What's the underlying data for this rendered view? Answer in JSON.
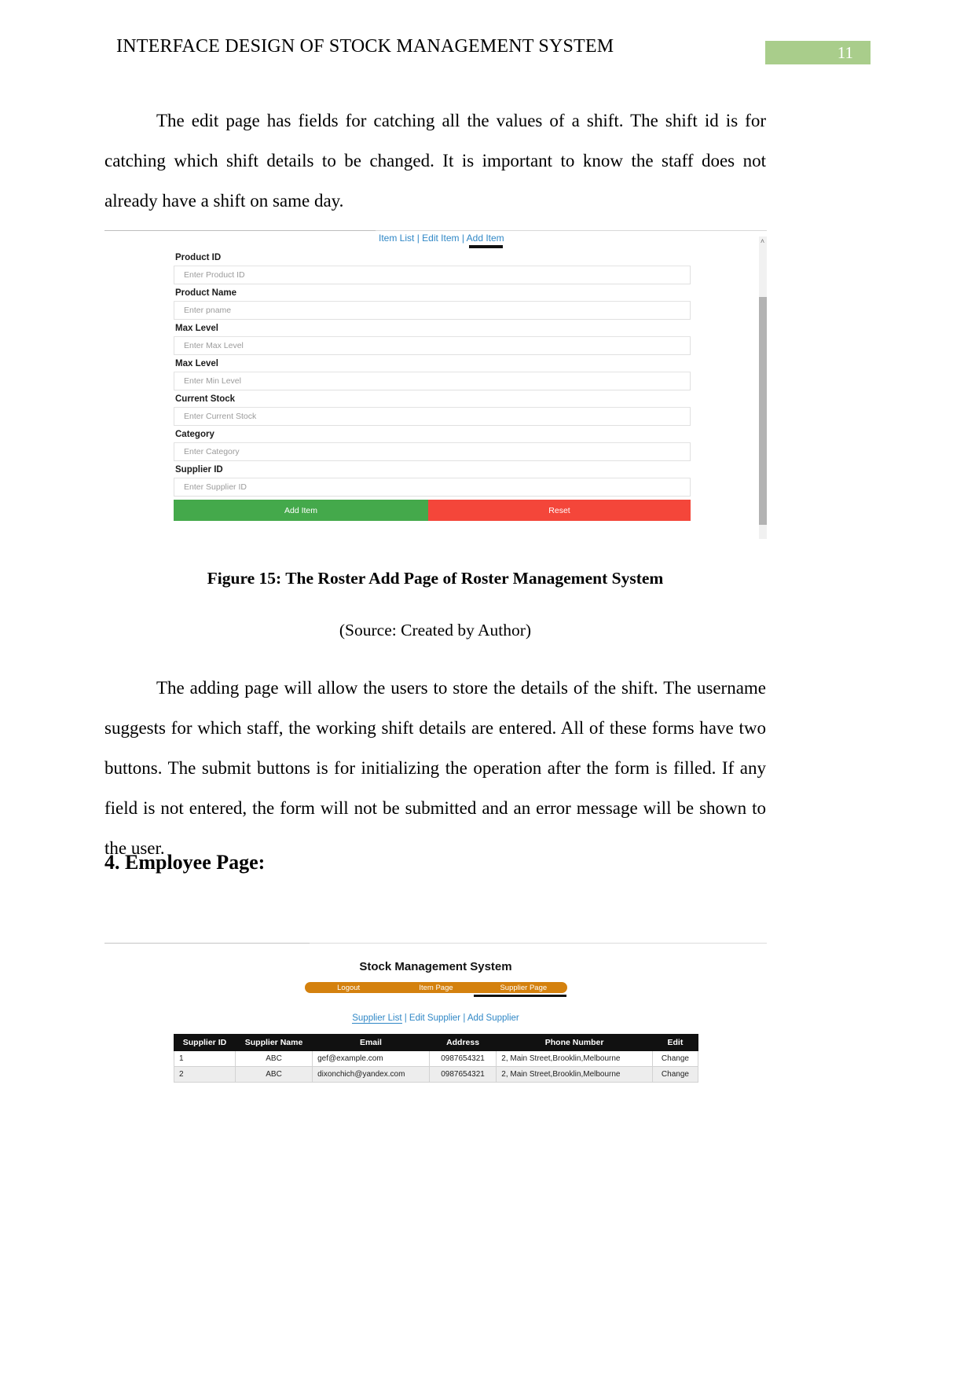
{
  "header": {
    "running_title": "INTERFACE DESIGN OF STOCK MANAGEMENT SYSTEM",
    "page_number": "11",
    "badge_color": "#a9cd8b"
  },
  "paragraphs": {
    "p1": "The edit page has fields for catching all the values of a shift. The shift id is for catching which shift details to be changed. It is important to know the staff does not already have a shift on same day.",
    "p2": "The adding page will allow the users to store the details of the shift. The username suggests for which staff, the working shift details are entered. All of these forms have two buttons. The submit buttons is for initializing the operation after the form is filled. If any field is not entered, the form will not be submitted and an error message will be shown to the user."
  },
  "figure1": {
    "caption": "Figure 15: The Roster Add Page of Roster Management System",
    "source": "(Source: Created by Author)",
    "nav": {
      "item_list": "Item List",
      "separator": " | ",
      "edit_item": "Edit Item",
      "add_item": "Add Item"
    },
    "fields": [
      {
        "label": "Product ID",
        "placeholder": "Enter Product ID"
      },
      {
        "label": "Product Name",
        "placeholder": "Enter pname"
      },
      {
        "label": "Max Level",
        "placeholder": "Enter Max Level"
      },
      {
        "label": "Max Level",
        "placeholder": "Enter Min Level"
      },
      {
        "label": "Current Stock",
        "placeholder": "Enter Current Stock"
      },
      {
        "label": "Category",
        "placeholder": "Enter Category"
      },
      {
        "label": "Supplier ID",
        "placeholder": "Enter Supplier ID"
      }
    ],
    "buttons": {
      "add": "Add Item",
      "add_color": "#44a94b",
      "reset": "Reset",
      "reset_color": "#f4463a"
    },
    "scroll_up_arrow": "˄"
  },
  "section": {
    "heading": "4. Employee Page:"
  },
  "figure2": {
    "title": "Stock Management System",
    "navbar": {
      "color": "#d4810e",
      "items": [
        {
          "label": "Logout"
        },
        {
          "label": "Item Page"
        },
        {
          "label": "Supplier Page"
        }
      ]
    },
    "sublinks": {
      "supplier_list": "Supplier List",
      "sep1": " | ",
      "edit_supplier": "Edit Supplier",
      "sep2": " | ",
      "add_supplier": "Add Supplier"
    },
    "table": {
      "columns": [
        "Supplier ID",
        "Supplier Name",
        "Email",
        "Address",
        "Phone Number",
        "Edit"
      ],
      "rows": [
        {
          "supplier_id": "1",
          "supplier_name": "ABC",
          "email": "gef@example.com",
          "address": "0987654321",
          "phone": "2, Main Street,Brooklin,Melbourne",
          "edit": "Change"
        },
        {
          "supplier_id": "2",
          "supplier_name": "ABC",
          "email": "dixonchich@yandex.com",
          "address": "0987654321",
          "phone": "2, Main Street,Brooklin,Melbourne",
          "edit": "Change"
        }
      ],
      "edit_link_color": "#e03a2f"
    }
  }
}
